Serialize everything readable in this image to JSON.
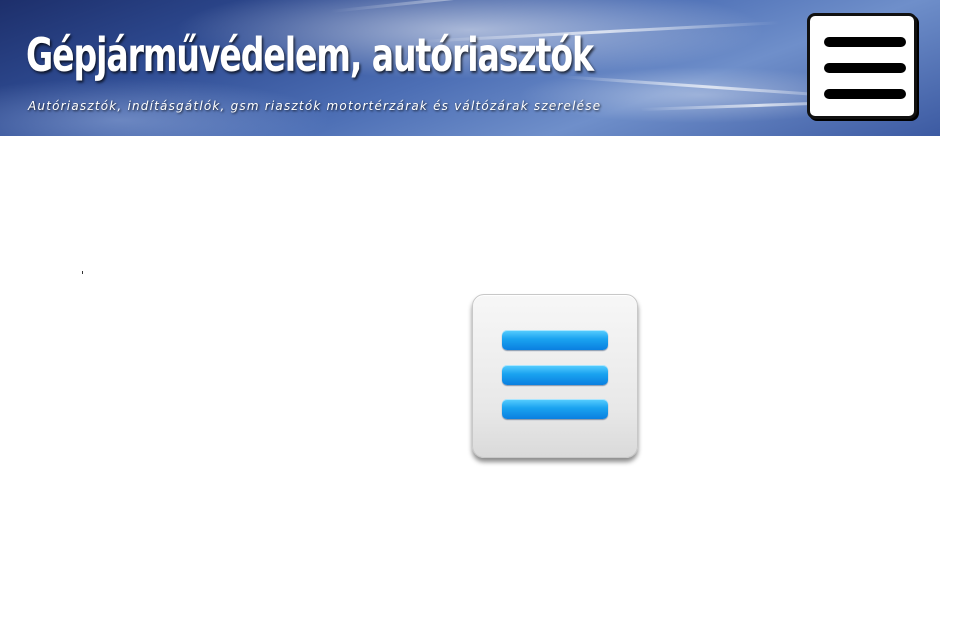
{
  "header": {
    "title": "Gépjárművédelem, autóriasztók",
    "subtitle": "Autóriasztók, indításgátlók, gsm riasztók motortérzárak és váltózárak szerelése",
    "background_color": "#3c5aa2"
  },
  "menu_toggle": {
    "icon": "hamburger-icon",
    "border_color": "#111111",
    "bar_color": "#000000"
  },
  "main": {
    "menu_icon": {
      "icon": "menu-list-icon",
      "bar_color": "#1aa3f0"
    }
  }
}
